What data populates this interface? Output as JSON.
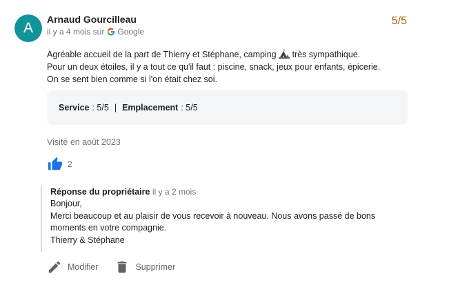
{
  "review": {
    "avatar_letter": "A",
    "author": "Arnaud Gourcilleau",
    "time": "il y a 4 mois sur",
    "source": "Google",
    "score": "5/5",
    "text_before_icon": "Agréable accueil de la part de Thierry et Stéphane, camping",
    "text_after_icon": "très sympathique.",
    "text_line2": "Pour un deux étoiles, il y a tout ce qu'il faut : piscine, snack, jeux pour enfants, épicerie.",
    "text_line3": "On se sent bien comme si l'on était chez soi.",
    "ratings": {
      "service_label": "Service",
      "service_value": ": 5/5",
      "separator": "|",
      "location_label": "Emplacement",
      "location_value": ": 5/5"
    },
    "visited": "Visité en août 2023",
    "likes": "2"
  },
  "reply": {
    "owner_label": "Réponse du propriétaire",
    "time": "il y a 2 mois",
    "body": "Bonjour,\nMerci beaucoup et au plaisir de vous recevoir à nouveau. Nous avons passé de bons moments en votre compagnie.\nThierry & Stéphane"
  },
  "actions": {
    "edit_label": "Modifier",
    "delete_label": "Supprimer"
  },
  "colors": {
    "avatar": "#12939a",
    "score": "#b06000",
    "like": "#1a73e8",
    "ratings_bg": "#f4f5f7"
  },
  "icons": {
    "source": "google-g-icon",
    "tent": "tent-icon",
    "like": "thumbs-up-icon",
    "edit": "pencil-icon",
    "delete": "trash-icon"
  }
}
